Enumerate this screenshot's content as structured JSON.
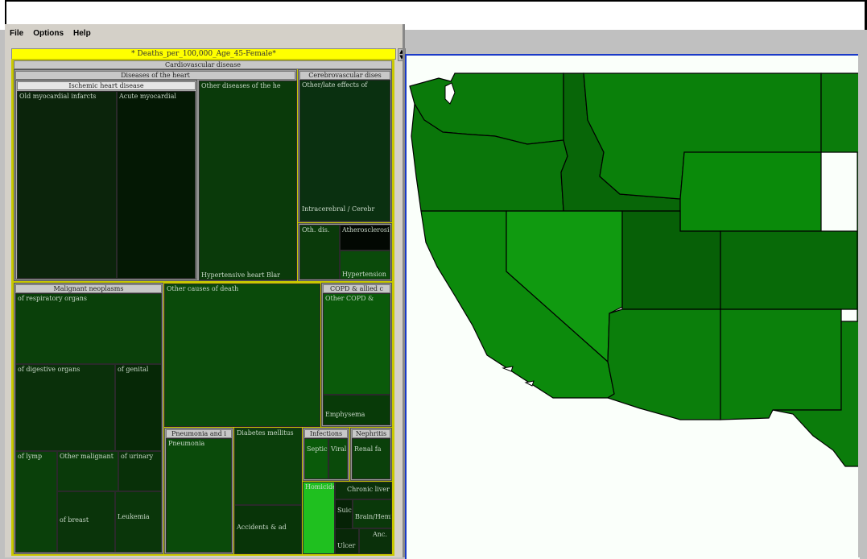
{
  "menu": {
    "items": [
      "File",
      "Options",
      "Help"
    ]
  },
  "window_title": "* Deaths_per_100,000_Age_45-Female*",
  "treemap": {
    "root_label": "Cardiovascular disease",
    "groups": {
      "heart": {
        "label": "Diseases of the heart",
        "ischemic": {
          "label": "Ischemic heart disease",
          "leaves": [
            "Old myocardial infarcts",
            "Acute myocardial"
          ]
        },
        "other_label": "Other diseases of the he",
        "hypertensive_label": "Hypertensive heart Blar"
      },
      "cerebro": {
        "label": "Cerebrovascular dises",
        "leaves": [
          "Other/late effects of",
          "Intracerebral / Cerebr"
        ]
      },
      "other_cardio": {
        "leaves": [
          "Oth. dis.",
          "Atherosclerosis",
          "Hypertension"
        ]
      },
      "malignant": {
        "label": "Malignant neoplasms",
        "leaves": [
          "of respiratory organs",
          "of digestive organs",
          "of genital",
          "of lymp",
          "Other malignant",
          "of urinary",
          "of breast",
          "Leukemia"
        ]
      },
      "other_causes_label": "Other causes of death",
      "copd": {
        "label": "COPD & allied c",
        "leaves": [
          "Other COPD &",
          "Emphysema"
        ]
      },
      "pneumonia": {
        "label": "Pneumonia and i",
        "leaf": "Pneumonia"
      },
      "diabetes_label": "Diabetes mellitus",
      "accidents_label": "Accidents & ad",
      "infections": {
        "label": "Infections",
        "leaves": [
          "Septic",
          "Viral"
        ]
      },
      "nephritis": {
        "label": "Nephritis",
        "leaf": "Renal fa"
      },
      "small_leaves": [
        "Homicide",
        "Chronic liver",
        "Suicide",
        "Brain/Hemis",
        "Ulcer",
        "Anc."
      ]
    }
  },
  "map": {
    "states": [
      {
        "name": "Washington",
        "color": "#0a7a0a"
      },
      {
        "name": "Oregon",
        "color": "#0a760a"
      },
      {
        "name": "Idaho",
        "color": "#086608"
      },
      {
        "name": "Montana",
        "color": "#0a800a"
      },
      {
        "name": "Wyoming",
        "color": "#0a8a0a"
      },
      {
        "name": "California",
        "color": "#0c8a0c"
      },
      {
        "name": "Nevada",
        "color": "#109a10"
      },
      {
        "name": "Utah",
        "color": "#076007"
      },
      {
        "name": "Colorado",
        "color": "#086a08"
      },
      {
        "name": "Arizona",
        "color": "#0b7e0b"
      },
      {
        "name": "New Mexico",
        "color": "#0b800b"
      },
      {
        "name": "Texas",
        "color": "#0b7c0b"
      }
    ]
  }
}
